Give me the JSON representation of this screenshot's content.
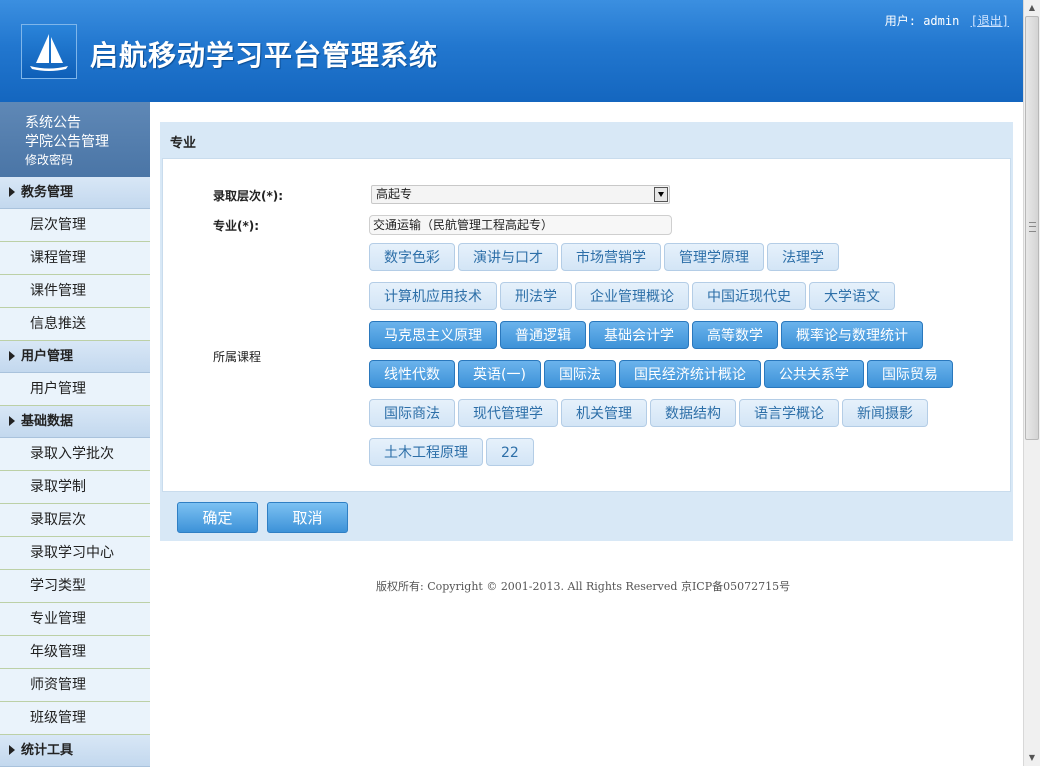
{
  "header": {
    "title": "启航移动学习平台管理系统",
    "user_label": "用户:",
    "username": "admin",
    "logout": "[退出]"
  },
  "sidebar": {
    "top_links": [
      "系统公告",
      "学院公告管理",
      "修改密码"
    ],
    "groups": [
      {
        "title": "教务管理",
        "items": [
          "层次管理",
          "课程管理",
          "课件管理",
          "信息推送"
        ]
      },
      {
        "title": "用户管理",
        "items": [
          "用户管理"
        ]
      },
      {
        "title": "基础数据",
        "items": [
          "录取入学批次",
          "录取学制",
          "录取层次",
          "录取学习中心",
          "学习类型",
          "专业管理",
          "年级管理",
          "师资管理",
          "班级管理"
        ]
      },
      {
        "title": "统计工具",
        "items": []
      }
    ]
  },
  "form": {
    "section_title": "专业",
    "level_label": "录取层次(*):",
    "level_value": "高起专",
    "major_label": "专业(*):",
    "major_value": "交通运输（民航管理工程高起专）",
    "courses_label": "所属课程",
    "courses": [
      [
        {
          "name": "数字色彩",
          "selected": false
        },
        {
          "name": "演讲与口才",
          "selected": false
        },
        {
          "name": "市场营销学",
          "selected": false
        },
        {
          "name": "管理学原理",
          "selected": false
        },
        {
          "name": "法理学",
          "selected": false
        }
      ],
      [
        {
          "name": "计算机应用技术",
          "selected": false
        },
        {
          "name": "刑法学",
          "selected": false
        },
        {
          "name": "企业管理概论",
          "selected": false
        },
        {
          "name": "中国近现代史",
          "selected": false
        },
        {
          "name": "大学语文",
          "selected": false
        }
      ],
      [
        {
          "name": "马克思主义原理",
          "selected": true
        },
        {
          "name": "普通逻辑",
          "selected": true
        },
        {
          "name": "基础会计学",
          "selected": true
        },
        {
          "name": "高等数学",
          "selected": true
        },
        {
          "name": "概率论与数理统计",
          "selected": true
        }
      ],
      [
        {
          "name": "线性代数",
          "selected": true
        },
        {
          "name": "英语(一)",
          "selected": true
        },
        {
          "name": "国际法",
          "selected": true
        },
        {
          "name": "国民经济统计概论",
          "selected": true
        },
        {
          "name": "公共关系学",
          "selected": true
        },
        {
          "name": "国际贸易",
          "selected": true
        }
      ],
      [
        {
          "name": "国际商法",
          "selected": false
        },
        {
          "name": "现代管理学",
          "selected": false
        },
        {
          "name": "机关管理",
          "selected": false
        },
        {
          "name": "数据结构",
          "selected": false
        },
        {
          "name": "语言学概论",
          "selected": false
        },
        {
          "name": "新闻摄影",
          "selected": false
        }
      ],
      [
        {
          "name": "土木工程原理",
          "selected": false
        },
        {
          "name": "22",
          "selected": false
        }
      ]
    ],
    "confirm": "确定",
    "cancel": "取消"
  },
  "footer": {
    "copyright": "版权所有: Copyright © 2001-2013. All Rights Reserved 京ICP备05072715号"
  }
}
